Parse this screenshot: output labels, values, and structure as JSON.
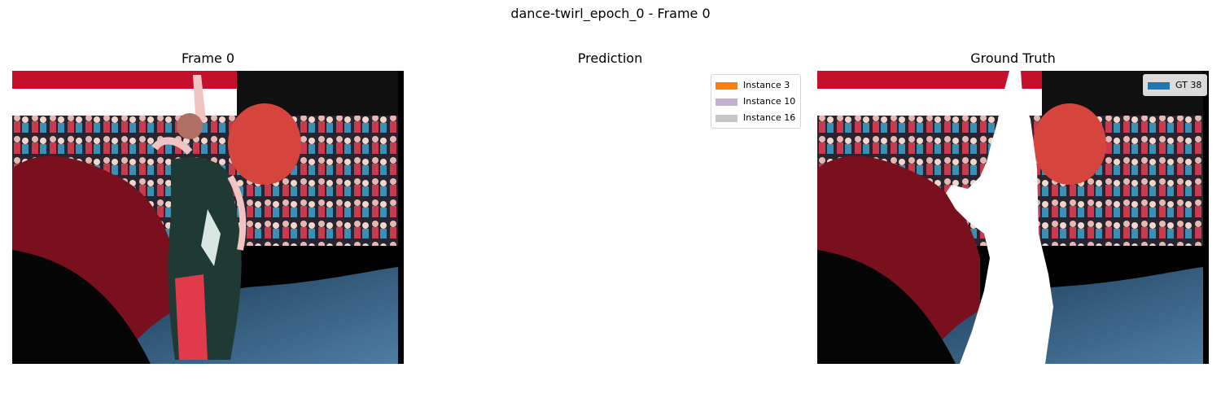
{
  "figure": {
    "suptitle": "dance-twirl_epoch_0 - Frame 0"
  },
  "panels": {
    "frame": {
      "title": "Frame 0"
    },
    "prediction": {
      "title": "Prediction",
      "legend": [
        {
          "label": "Instance 3",
          "color": "#ff7f0e"
        },
        {
          "label": "Instance 10",
          "color": "#c5b0d5"
        },
        {
          "label": "Instance 16",
          "color": "#c7c7c7"
        }
      ]
    },
    "ground_truth": {
      "title": "Ground Truth",
      "legend": [
        {
          "label": "GT 38",
          "color": "#1f77b4"
        }
      ]
    }
  },
  "chart_data": {
    "type": "image-grid",
    "title": "dance-twirl_epoch_0 - Frame 0",
    "panels": [
      {
        "title": "Frame 0",
        "content": "input video frame: dancer twirling in front of seated crowd",
        "axis": "off"
      },
      {
        "title": "Prediction",
        "content": "blank (no mask drawn)",
        "axis": "off",
        "legend": [
          "Instance 3",
          "Instance 10",
          "Instance 16"
        ],
        "legend_position": "top-right"
      },
      {
        "title": "Ground Truth",
        "content": "input frame with dancer mask filled white",
        "axis": "off",
        "legend": [
          "GT 38"
        ],
        "legend_position": "top-right"
      }
    ]
  }
}
